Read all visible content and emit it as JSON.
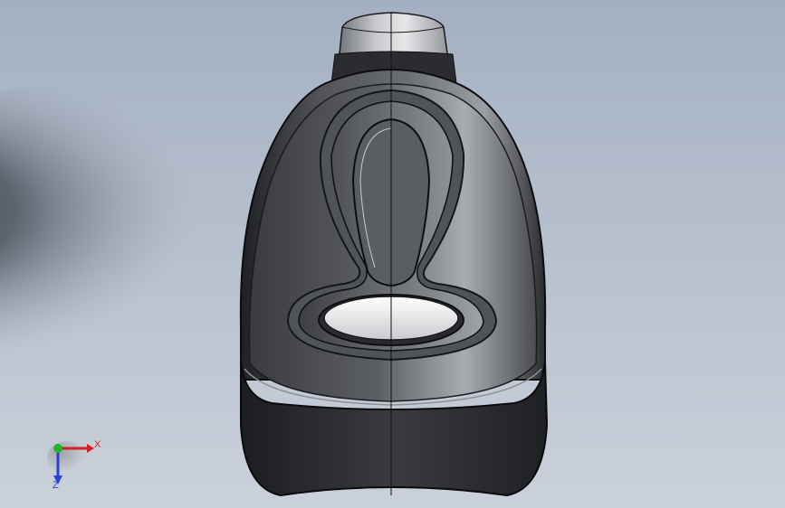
{
  "viewport": {
    "background_top": "#aab6c8",
    "background_bottom": "#c9cfd8",
    "model_body": "#2c2d31",
    "model_highlight": "#8a8d92",
    "model_window": "#e9eaec"
  },
  "triad": {
    "x_label": "X",
    "z_label": "Z",
    "x_color": "#d42020",
    "y_color": "#26b526",
    "z_color": "#2a3fd4"
  }
}
